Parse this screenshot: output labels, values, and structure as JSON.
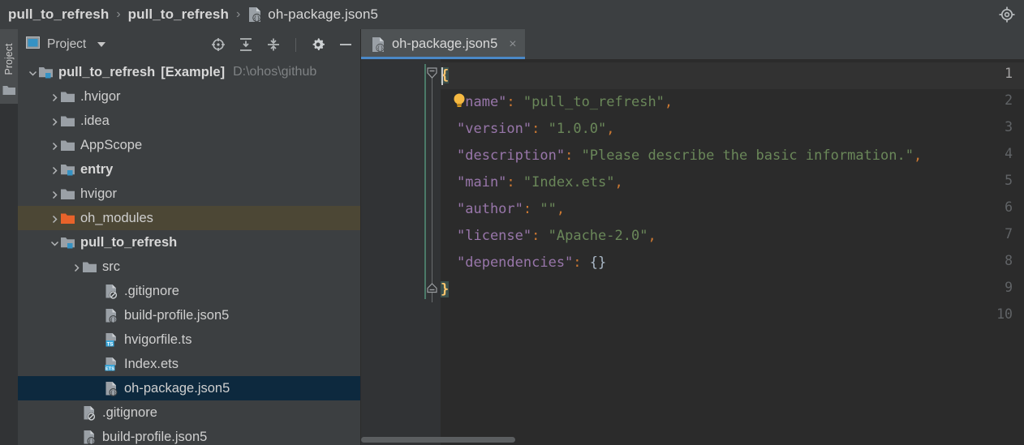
{
  "window": {
    "breadcrumb": [
      {
        "label": "pull_to_refresh",
        "bold": true,
        "icon": ""
      },
      {
        "label": "pull_to_refresh",
        "bold": true,
        "icon": ""
      },
      {
        "label": "oh-package.json5",
        "bold": false,
        "icon": "json5-file-icon"
      }
    ],
    "separator": "›",
    "right_icon": "settings-target-icon"
  },
  "toolstrip": {
    "label": "Project",
    "icon": "folder-icon"
  },
  "project_panel": {
    "title": "Project",
    "title_icon": "project-view-icon",
    "dropdown_icon": "chevron-down-icon",
    "toolbar_icons": [
      {
        "name": "select-opened-file-icon",
        "title": "Select Opened File"
      },
      {
        "name": "expand-all-icon",
        "title": "Expand All"
      },
      {
        "name": "collapse-all-icon",
        "title": "Collapse All"
      },
      {
        "name": "settings-gear-icon",
        "title": "Settings"
      },
      {
        "name": "hide-minimize-icon",
        "title": "Hide"
      }
    ],
    "tree": [
      {
        "label": "pull_to_refresh",
        "suffix": "[Example]",
        "path": "D:\\ohos\\github",
        "icon": "module-folder-icon",
        "arrow": "expanded",
        "indent": 0,
        "bold": true,
        "state": "normal"
      },
      {
        "label": ".hvigor",
        "suffix": "",
        "path": "",
        "icon": "folder-icon",
        "arrow": "collapsed",
        "indent": 1,
        "bold": false,
        "state": "normal"
      },
      {
        "label": ".idea",
        "suffix": "",
        "path": "",
        "icon": "folder-icon",
        "arrow": "collapsed",
        "indent": 1,
        "bold": false,
        "state": "normal"
      },
      {
        "label": "AppScope",
        "suffix": "",
        "path": "",
        "icon": "folder-icon",
        "arrow": "collapsed",
        "indent": 1,
        "bold": false,
        "state": "normal"
      },
      {
        "label": "entry",
        "suffix": "",
        "path": "",
        "icon": "module-folder-icon",
        "arrow": "collapsed",
        "indent": 1,
        "bold": true,
        "state": "normal"
      },
      {
        "label": "hvigor",
        "suffix": "",
        "path": "",
        "icon": "folder-icon",
        "arrow": "collapsed",
        "indent": 1,
        "bold": false,
        "state": "normal"
      },
      {
        "label": "oh_modules",
        "suffix": "",
        "path": "",
        "icon": "orange-folder-icon",
        "arrow": "collapsed",
        "indent": 1,
        "bold": false,
        "state": "highlighted"
      },
      {
        "label": "pull_to_refresh",
        "suffix": "",
        "path": "",
        "icon": "module-folder-icon",
        "arrow": "expanded",
        "indent": 1,
        "bold": true,
        "state": "normal"
      },
      {
        "label": "src",
        "suffix": "",
        "path": "",
        "icon": "folder-icon",
        "arrow": "collapsed",
        "indent": 2,
        "bold": false,
        "state": "normal"
      },
      {
        "label": ".gitignore",
        "suffix": "",
        "path": "",
        "icon": "gitignore-file-icon",
        "arrow": "none",
        "indent": 3,
        "bold": false,
        "state": "normal"
      },
      {
        "label": "build-profile.json5",
        "suffix": "",
        "path": "",
        "icon": "json5-file-icon",
        "arrow": "none",
        "indent": 3,
        "bold": false,
        "state": "normal"
      },
      {
        "label": "hvigorfile.ts",
        "suffix": "",
        "path": "",
        "icon": "ts-file-icon",
        "arrow": "none",
        "indent": 3,
        "bold": false,
        "state": "normal"
      },
      {
        "label": "Index.ets",
        "suffix": "",
        "path": "",
        "icon": "ets-file-icon",
        "arrow": "none",
        "indent": 3,
        "bold": false,
        "state": "normal"
      },
      {
        "label": "oh-package.json5",
        "suffix": "",
        "path": "",
        "icon": "json5-file-icon",
        "arrow": "none",
        "indent": 3,
        "bold": false,
        "state": "selected"
      },
      {
        "label": ".gitignore",
        "suffix": "",
        "path": "",
        "icon": "gitignore-file-icon",
        "arrow": "none",
        "indent": 2,
        "bold": false,
        "state": "normal"
      },
      {
        "label": "build-profile.json5",
        "suffix": "",
        "path": "",
        "icon": "json5-file-icon",
        "arrow": "none",
        "indent": 2,
        "bold": false,
        "state": "normal"
      }
    ]
  },
  "editor": {
    "tab": {
      "label": "oh-package.json5",
      "icon": "json5-file-icon",
      "close_label": "×",
      "active": true
    },
    "line_numbers": [
      "1",
      "2",
      "3",
      "4",
      "5",
      "6",
      "7",
      "8",
      "9",
      "10"
    ],
    "current_line": 1,
    "lines": [
      {
        "n": 1,
        "indent": 0,
        "tokens": [
          {
            "t": "{",
            "c": "brace-hl"
          }
        ]
      },
      {
        "n": 2,
        "indent": 1,
        "tokens": [
          {
            "t": "\"name\"",
            "c": "k"
          },
          {
            "t": ":",
            "c": "p"
          },
          {
            "t": " ",
            "c": "br"
          },
          {
            "t": "\"pull_to_refresh\"",
            "c": "s"
          },
          {
            "t": ",",
            "c": "p"
          }
        ]
      },
      {
        "n": 3,
        "indent": 1,
        "tokens": [
          {
            "t": "\"version\"",
            "c": "k"
          },
          {
            "t": ":",
            "c": "p"
          },
          {
            "t": " ",
            "c": "br"
          },
          {
            "t": "\"1.0.0\"",
            "c": "s"
          },
          {
            "t": ",",
            "c": "p"
          }
        ]
      },
      {
        "n": 4,
        "indent": 1,
        "tokens": [
          {
            "t": "\"description\"",
            "c": "k"
          },
          {
            "t": ":",
            "c": "p"
          },
          {
            "t": " ",
            "c": "br"
          },
          {
            "t": "\"Please describe the basic information.\"",
            "c": "s"
          },
          {
            "t": ",",
            "c": "p"
          }
        ]
      },
      {
        "n": 5,
        "indent": 1,
        "tokens": [
          {
            "t": "\"main\"",
            "c": "k"
          },
          {
            "t": ":",
            "c": "p"
          },
          {
            "t": " ",
            "c": "br"
          },
          {
            "t": "\"Index.ets\"",
            "c": "s"
          },
          {
            "t": ",",
            "c": "p"
          }
        ]
      },
      {
        "n": 6,
        "indent": 1,
        "tokens": [
          {
            "t": "\"author\"",
            "c": "k"
          },
          {
            "t": ":",
            "c": "p"
          },
          {
            "t": " ",
            "c": "br"
          },
          {
            "t": "\"\"",
            "c": "s"
          },
          {
            "t": ",",
            "c": "p"
          }
        ]
      },
      {
        "n": 7,
        "indent": 1,
        "tokens": [
          {
            "t": "\"license\"",
            "c": "k"
          },
          {
            "t": ":",
            "c": "p"
          },
          {
            "t": " ",
            "c": "br"
          },
          {
            "t": "\"Apache-2.0\"",
            "c": "s"
          },
          {
            "t": ",",
            "c": "p"
          }
        ]
      },
      {
        "n": 8,
        "indent": 1,
        "tokens": [
          {
            "t": "\"dependencies\"",
            "c": "k"
          },
          {
            "t": ":",
            "c": "p"
          },
          {
            "t": " ",
            "c": "br"
          },
          {
            "t": "{}",
            "c": "br"
          }
        ]
      },
      {
        "n": 9,
        "indent": 0,
        "tokens": [
          {
            "t": "}",
            "c": "brace-hl"
          }
        ]
      },
      {
        "n": 10,
        "indent": 0,
        "tokens": []
      }
    ],
    "raw_text": "{\n  \"name\": \"pull_to_refresh\",\n  \"version\": \"1.0.0\",\n  \"description\": \"Please describe the basic information.\",\n  \"main\": \"Index.ets\",\n  \"author\": \"\",\n  \"license\": \"Apache-2.0\",\n  \"dependencies\": {}\n}\n",
    "gutter_icons": [
      {
        "name": "fold-collapse-icon",
        "line": 1
      },
      {
        "name": "fold-collapse-end-icon",
        "line": 9
      },
      {
        "name": "intention-bulb-icon",
        "line": 2
      }
    ]
  },
  "colors": {
    "window_bg": "#3c3f41",
    "editor_bg": "#2b2b2b",
    "gutter_bg": "#313335",
    "selection": "#0d293e",
    "highlight_row": "#4c4735",
    "accent_blue": "#4a88c7",
    "key_purple": "#9876aa",
    "string_green": "#6a8759",
    "punct_orange": "#cc7832",
    "brace_yellow": "#ffc66d",
    "text": "#cfcfcf",
    "muted_text": "#7f8284"
  }
}
